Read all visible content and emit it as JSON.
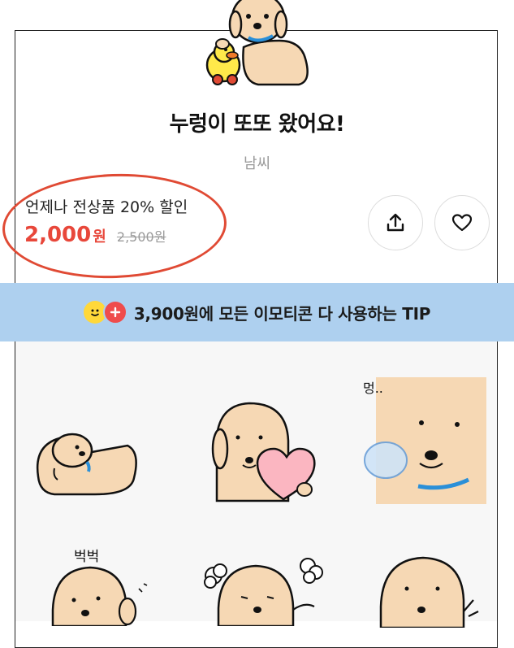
{
  "product": {
    "title": "누렁이 또또 왔어요!",
    "author": "남씨"
  },
  "pricing": {
    "promo_text": "언제나 전상품 20% 할인",
    "price_now": "2,000",
    "price_unit": "원",
    "price_original": "2,500원"
  },
  "actions": {
    "share_icon": "share-icon",
    "like_icon": "heart-icon"
  },
  "tip_banner": {
    "text": "3,900원에 모든 이모티콘 다 사용하는 TIP"
  },
  "stickers": [
    {
      "caption": ""
    },
    {
      "caption": ""
    },
    {
      "caption": "멍.."
    },
    {
      "caption": "벅벅"
    },
    {
      "caption": ""
    },
    {
      "caption": ""
    }
  ],
  "colors": {
    "accent_red": "#e8473a",
    "banner_blue": "#aed0ef",
    "dog_fur": "#f6d8b4"
  }
}
